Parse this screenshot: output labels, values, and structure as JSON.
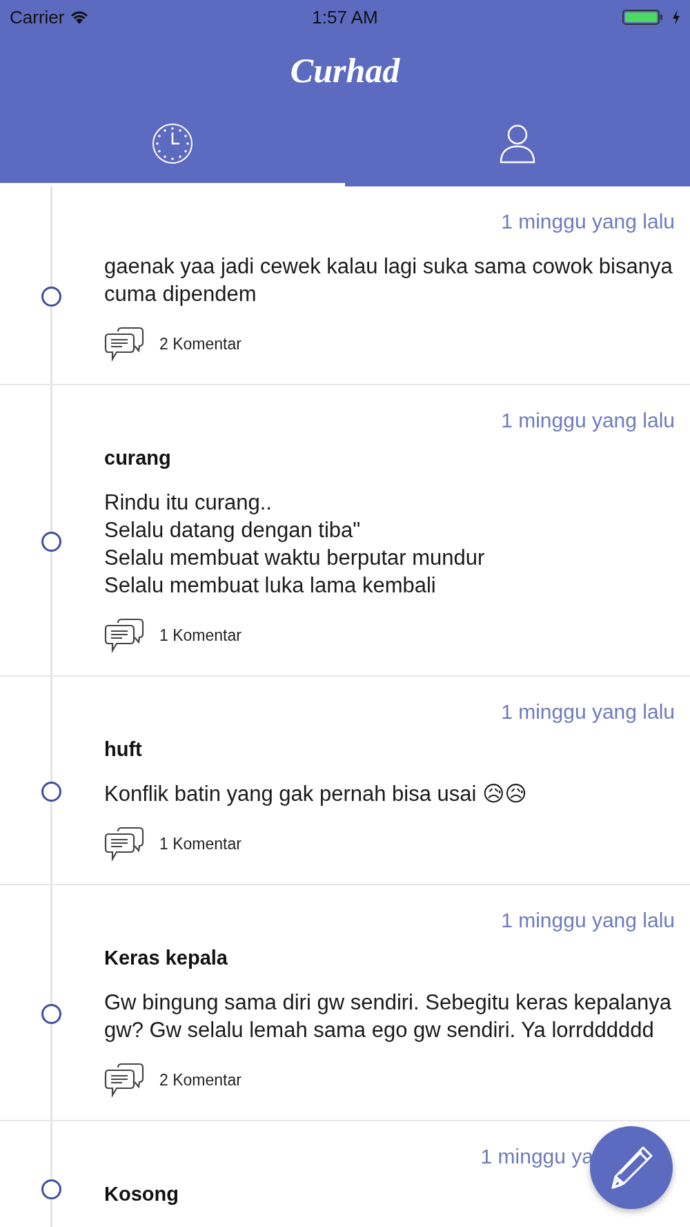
{
  "status_bar": {
    "carrier": "Carrier",
    "time": "1:57 AM"
  },
  "app_bar": {
    "title": "Curhad"
  },
  "tabs": [
    {
      "kind": "timeline",
      "selected": true
    },
    {
      "kind": "profile",
      "selected": false
    }
  ],
  "posts": [
    {
      "time": "1 minggu yang lalu",
      "body": "gaenak yaa jadi cewek kalau lagi suka sama cowok bisanya cuma dipendem",
      "comments": "2 Komentar"
    },
    {
      "time": "1 minggu yang lalu",
      "title": "curang",
      "body": "Rindu itu curang..\nSelalu datang dengan tiba\"\nSelalu membuat waktu berputar mundur\nSelalu membuat luka lama kembali",
      "comments": "1 Komentar"
    },
    {
      "time": "1 minggu yang lalu",
      "title": "huft",
      "body": "Konflik batin yang gak pernah bisa usai 😥😥",
      "comments": "1 Komentar"
    },
    {
      "time": "1 minggu yang lalu",
      "title": "Keras kepala",
      "body": "Gw bingung sama diri gw sendiri. Sebegitu keras kepalanya gw? Gw selalu lemah sama ego gw sendiri. Ya lorrdddddd",
      "comments": "2 Komentar"
    },
    {
      "time": "1 minggu ya",
      "title": "Kosong"
    }
  ]
}
